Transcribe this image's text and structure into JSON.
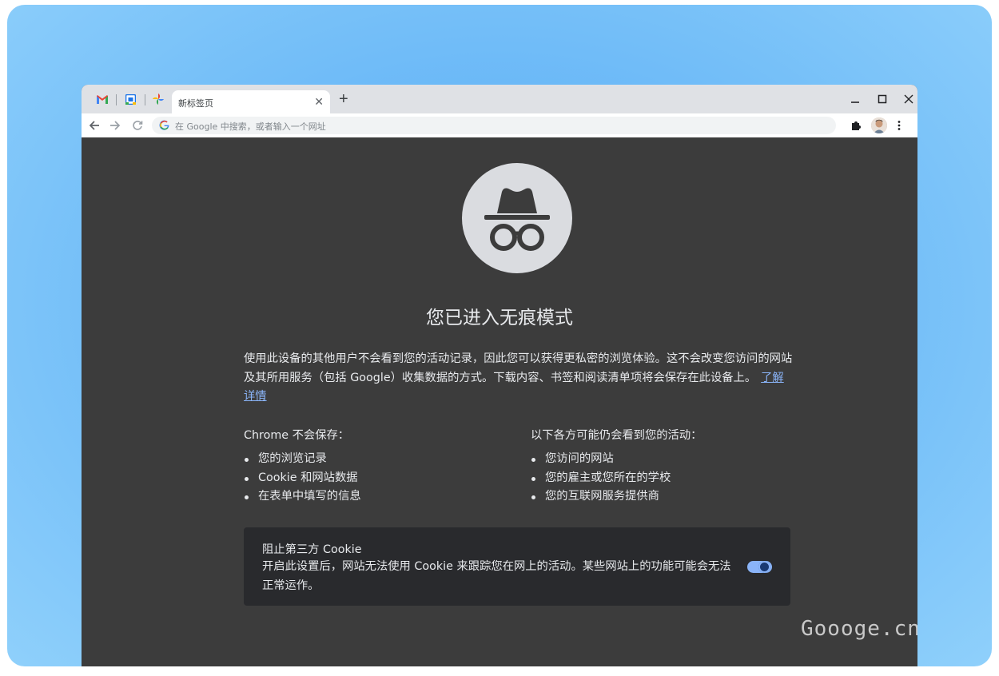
{
  "browser": {
    "pinned_tabs": [
      {
        "icon": "gmail-icon",
        "label": "M",
        "color": "#ea4335"
      },
      {
        "icon": "calendar-icon",
        "color": "#1a73e8"
      },
      {
        "icon": "photos-icon",
        "color": "#fbbc04"
      }
    ],
    "active_tab": {
      "title": "新标签页",
      "close": "✕"
    },
    "new_tab": "+",
    "window_controls": {
      "minimize": "–",
      "maximize": "☐",
      "close": "✕"
    },
    "omnibox": {
      "placeholder": "在 Google 中搜索，或者输入一个网址"
    }
  },
  "incognito": {
    "heading": "您已进入无痕模式",
    "description": "使用此设备的其他用户不会看到您的活动记录，因此您可以获得更私密的浏览体验。这不会改变您访问的网站及其所用服务（包括 Google）收集数据的方式。下载内容、书签和阅读清单项将会保存在此设备上。",
    "learn_more": "了解详情",
    "not_saved": {
      "title": "Chrome 不会保存：",
      "items": [
        "您的浏览记录",
        "Cookie 和网站数据",
        "在表单中填写的信息"
      ]
    },
    "may_see": {
      "title": "以下各方可能仍会看到您的活动：",
      "items": [
        "您访问的网站",
        "您的雇主或您所在的学校",
        "您的互联网服务提供商"
      ]
    },
    "cookie_control": {
      "title": "阻止第三方 Cookie",
      "description": "开启此设置后，网站无法使用 Cookie 来跟踪您在网上的活动。某些网站上的功能可能会无法正常运作。",
      "enabled": true
    }
  },
  "watermark": "Goooge.cn",
  "colors": {
    "background_gradient": "#6ab8f7",
    "content_bg": "#3c3c3c",
    "link": "#8ab4f8",
    "cookie_box_bg": "#292a2d"
  }
}
